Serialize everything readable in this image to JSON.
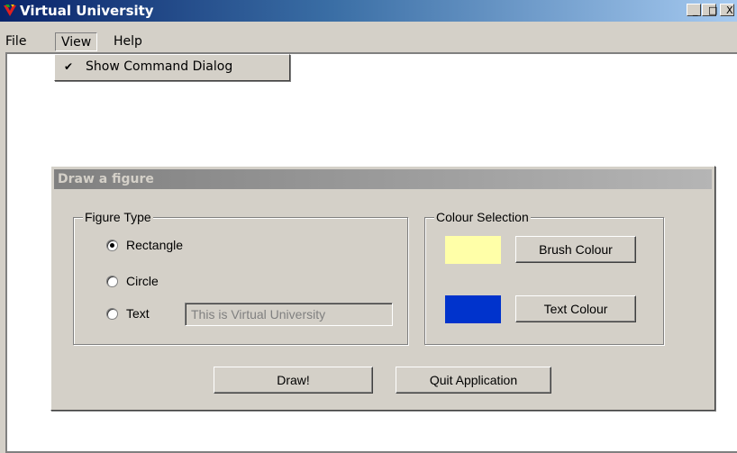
{
  "window": {
    "title": "Virtual University",
    "controls": {
      "minimize": "_",
      "maximize": "□",
      "close": "X"
    }
  },
  "menubar": {
    "items": [
      {
        "label": "File"
      },
      {
        "label": "View"
      },
      {
        "label": "Help"
      }
    ],
    "view_dropdown": {
      "items": [
        {
          "label": "Show Command Dialog",
          "checked": true
        }
      ]
    }
  },
  "dialog": {
    "title": "Draw a figure",
    "figure_type": {
      "legend": "Figure Type",
      "options": [
        {
          "label": "Rectangle",
          "selected": true
        },
        {
          "label": "Circle",
          "selected": false
        },
        {
          "label": "Text",
          "selected": false
        }
      ],
      "text_value": "This is Virtual University"
    },
    "colour_selection": {
      "legend": "Colour Selection",
      "brush_colour": "#ffffa8",
      "text_colour": "#0033cc",
      "brush_button": "Brush Colour",
      "text_button": "Text Colour"
    },
    "buttons": {
      "draw": "Draw!",
      "quit": "Quit Application"
    }
  },
  "icons": {
    "app": "virtual-university-logo-icon",
    "check": "checkmark-icon"
  }
}
